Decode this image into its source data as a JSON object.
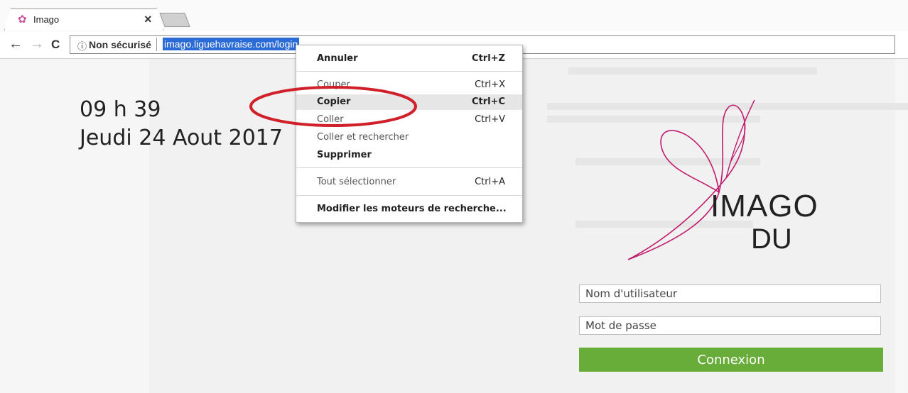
{
  "browser": {
    "tab": {
      "title": "Imago",
      "close_label": "×"
    },
    "nav": {
      "back": "←",
      "forward": "→",
      "reload": "C"
    },
    "address": {
      "security_icon": "ⓘ",
      "security_label": "Non sécurisé",
      "url": "imago.liguehavraise.com/login"
    }
  },
  "page": {
    "clock": {
      "time": "09 h 39",
      "date": "Jeudi 24 Aout 2017"
    },
    "logo": {
      "line1": "IMAGO",
      "line2": "DU"
    },
    "login": {
      "username_placeholder": "Nom d'utilisateur",
      "password_placeholder": "Mot de passe",
      "submit_label": "Connexion"
    }
  },
  "context_menu": {
    "items": [
      {
        "label": "Annuler",
        "shortcut": "Ctrl+Z"
      },
      {
        "label": "Couper",
        "shortcut": "Ctrl+X"
      },
      {
        "label": "Copier",
        "shortcut": "Ctrl+C"
      },
      {
        "label": "Coller",
        "shortcut": "Ctrl+V"
      },
      {
        "label": "Coller et rechercher",
        "shortcut": ""
      },
      {
        "label": "Supprimer",
        "shortcut": ""
      },
      {
        "label": "Tout sélectionner",
        "shortcut": "Ctrl+A"
      },
      {
        "label": "Modifier les moteurs de recherche...",
        "shortcut": ""
      }
    ]
  },
  "colors": {
    "accent_green": "#68ac3a",
    "url_selection": "#2b6bd6",
    "logo_magenta": "#c01a6d",
    "annotation_red": "#d0202a"
  },
  "icons": {
    "tab_favicon": "imago-logo-icon",
    "security": "info-icon"
  }
}
